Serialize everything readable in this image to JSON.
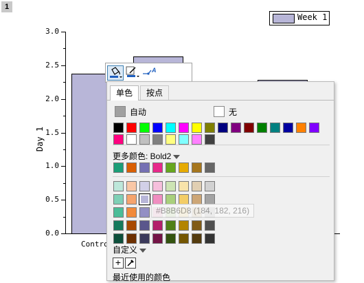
{
  "page_tab": "1",
  "legend": {
    "label": "Week 1",
    "color": "#b8b6d8"
  },
  "chart_data": {
    "type": "bar",
    "categories": [
      "Control"
    ],
    "series": [
      {
        "name": "Week 1",
        "values": [
          2.38,
          2.63,
          2.28
        ]
      }
    ],
    "ylabel": "Day 1",
    "ylim": [
      0,
      3.0
    ],
    "yticks": [
      "0.0",
      "0.5",
      "1.0",
      "1.5",
      "2.0",
      "2.5",
      "3.0"
    ],
    "bar_color": "#b8b6d8"
  },
  "mini_toolbar": {
    "icons": [
      "fill-color-icon",
      "line-color-icon",
      "line-style-icon"
    ]
  },
  "color_popup": {
    "tabs": [
      "单色",
      "按点"
    ],
    "auto_label": "自动",
    "none_label": "无",
    "main_colors": [
      "#000000",
      "#ff0000",
      "#00ff00",
      "#0000ff",
      "#00ffff",
      "#ff00ff",
      "#ffff00",
      "#808000",
      "#000080",
      "#800080",
      "#800000",
      "#008000",
      "#008080",
      "#0000a0",
      "#ff8000",
      "#8000ff",
      "#ff0080",
      "#ffffff",
      "#c0c0c0",
      "#808080",
      "#ffff80",
      "#80ffff",
      "#ff80ff",
      "#404040"
    ],
    "more_colors_label": "更多颜色: Bold2",
    "bold2_colors": [
      "#1b9e77",
      "#d95f02",
      "#7570b3",
      "#e7298a",
      "#66a61e",
      "#e6ab02",
      "#a6761d",
      "#666666"
    ],
    "shade_rows": [
      [
        "#bde7da",
        "#f9c7a5",
        "#d2d0e8",
        "#f6bfdc",
        "#cde4b4",
        "#f8e3aa",
        "#e1cfb2",
        "#d1d1d1"
      ],
      [
        "#7fd0b6",
        "#f6a46d",
        "#b8b6d8",
        "#f08ec0",
        "#a9d07c",
        "#f3cd67",
        "#cda676",
        "#a3a3a3"
      ],
      [
        "#4bbd98",
        "#f28a3a",
        "#938fc4",
        "#ea5ea5",
        "#86bc45",
        "#efbb30",
        "#b98f45",
        "#858585"
      ],
      [
        "#157a5c",
        "#a84a02",
        "#5a568c",
        "#b31f6b",
        "#4f8017",
        "#b38401",
        "#815b16",
        "#4f4f4f"
      ],
      [
        "#0d4f3b",
        "#6d3001",
        "#3b3a5b",
        "#741446",
        "#33530f",
        "#745601",
        "#543b0e",
        "#333333"
      ]
    ],
    "selected_color": "#b8b6d8",
    "tooltip": "#B8B6D8 (184, 182, 216)",
    "custom_label": "自定义",
    "recent_label": "最近使用的颜色"
  }
}
